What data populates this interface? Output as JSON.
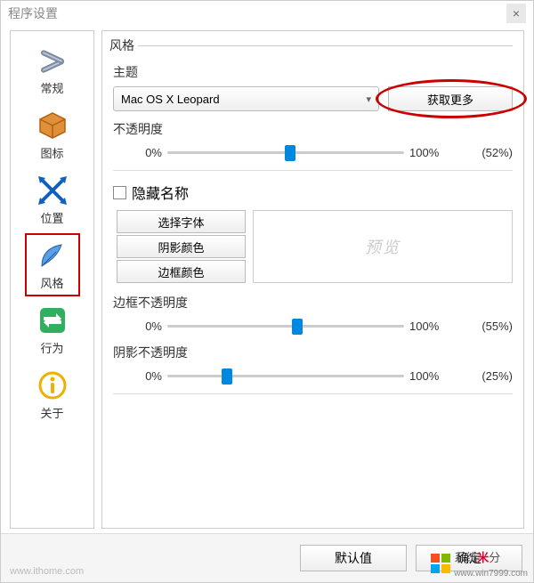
{
  "window": {
    "title": "程序设置",
    "close_glyph": "×"
  },
  "sidebar": {
    "items": [
      {
        "label": "常规",
        "icon": "tools-icon"
      },
      {
        "label": "图标",
        "icon": "box-icon"
      },
      {
        "label": "位置",
        "icon": "arrows-cross-icon"
      },
      {
        "label": "风格",
        "icon": "feather-icon",
        "selected": true
      },
      {
        "label": "行为",
        "icon": "swap-icon"
      },
      {
        "label": "关于",
        "icon": "info-icon"
      }
    ]
  },
  "content": {
    "group_title": "风格",
    "theme_label": "主题",
    "theme_value": "Mac OS X Leopard",
    "get_more": "获取更多",
    "opacity_label": "不透明度",
    "opacity": {
      "min_label": "0%",
      "max_label": "100%",
      "value_pct": "(52%)",
      "pos": 52
    },
    "hide_name_checked": false,
    "hide_name_label": "隐藏名称",
    "font_button": "选择字体",
    "shadow_color_button": "阴影颜色",
    "border_color_button": "边框颜色",
    "preview_text": "预览",
    "border_opacity_label": "边框不透明度",
    "border_opacity": {
      "min_label": "0%",
      "max_label": "100%",
      "value_pct": "(55%)",
      "pos": 55
    },
    "shadow_opacity_label": "阴影不透明度",
    "shadow_opacity": {
      "min_label": "0%",
      "max_label": "100%",
      "value_pct": "(25%)",
      "pos": 25
    }
  },
  "buttons": {
    "default": "默认值",
    "ok": "确定"
  },
  "watermark": {
    "left": "www.ithome.com",
    "right_prefix": "系统",
    "right_suffix": "分",
    "right_url": "www.win7999.com"
  }
}
